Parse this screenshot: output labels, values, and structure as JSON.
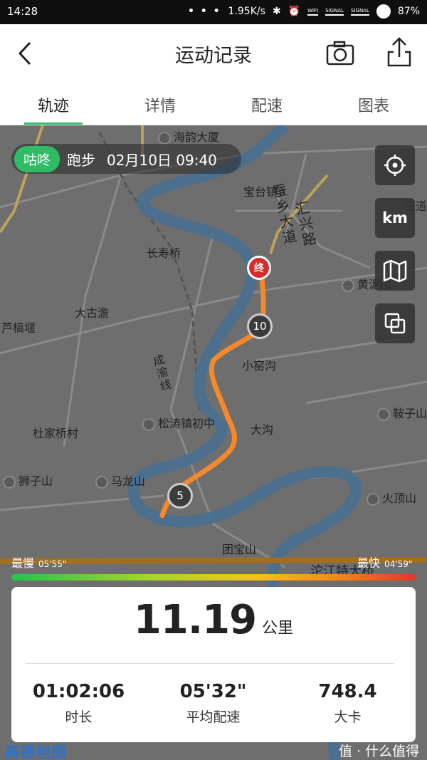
{
  "status_bar": {
    "time": "14:28",
    "dots": "• • •",
    "speed": "1.95K/s",
    "wifi": "WIFI",
    "signal1": "SIGNAL",
    "signal2": "SIGNAL",
    "battery": "87%"
  },
  "header": {
    "title": "运动记录",
    "back_icon": "chevron-left-icon",
    "camera_icon": "camera-icon",
    "share_icon": "share-icon"
  },
  "tabs": [
    {
      "label": "轨迹",
      "active": true
    },
    {
      "label": "详情",
      "active": false
    },
    {
      "label": "配速",
      "active": false
    },
    {
      "label": "图表",
      "active": false
    }
  ],
  "activity": {
    "brand": "咕咚",
    "type": "跑步",
    "date": "02月10日 09:40"
  },
  "map_controls": {
    "locate_icon": "crosshair-icon",
    "unit": "km",
    "layers_icon": "map-icon",
    "overlay_icon": "overlap-icon"
  },
  "map_labels": {
    "haiyun": "海韵大厦",
    "baotai": "宝台镇",
    "sanhu": "三道",
    "chuanxing": "蚕乡大道",
    "huixing": "汇兴路",
    "changshou": "长寿桥",
    "huangni": "黄泥山",
    "dagu": "大古澹",
    "lugao": "芦槁堰",
    "xiaoyao": "小窑沟",
    "chengyu": "成渝线",
    "songtao": "松涛镇初中",
    "dagou": "大沟",
    "dujia": "杜家桥村",
    "ezi": "鞍子山",
    "shizi": "狮子山",
    "malong": "马龙山",
    "huoding": "火顶山",
    "tuanbao": "团宝山",
    "tuojiang": "沱江特大桥"
  },
  "route_markers": {
    "end": "终",
    "km10": "10",
    "km5": "5"
  },
  "pace_legend": {
    "slowest_label": "最慢",
    "slowest_value": "05'55\"",
    "fastest_label": "最快",
    "fastest_value": "04'59\""
  },
  "summary": {
    "distance": "11.19",
    "distance_unit": "公里",
    "stats": [
      {
        "value": "01:02:06",
        "label": "时长"
      },
      {
        "value": "05'32\"",
        "label": "平均配速"
      },
      {
        "value": "748.4",
        "label": "大卡"
      }
    ]
  },
  "footer": {
    "amap_logo": "高德地图",
    "watermark": "值 · 什么值得买"
  },
  "colors": {
    "accent_green": "#2ebd65",
    "route_orange": "#f5882a",
    "end_red": "#d82c2c"
  }
}
